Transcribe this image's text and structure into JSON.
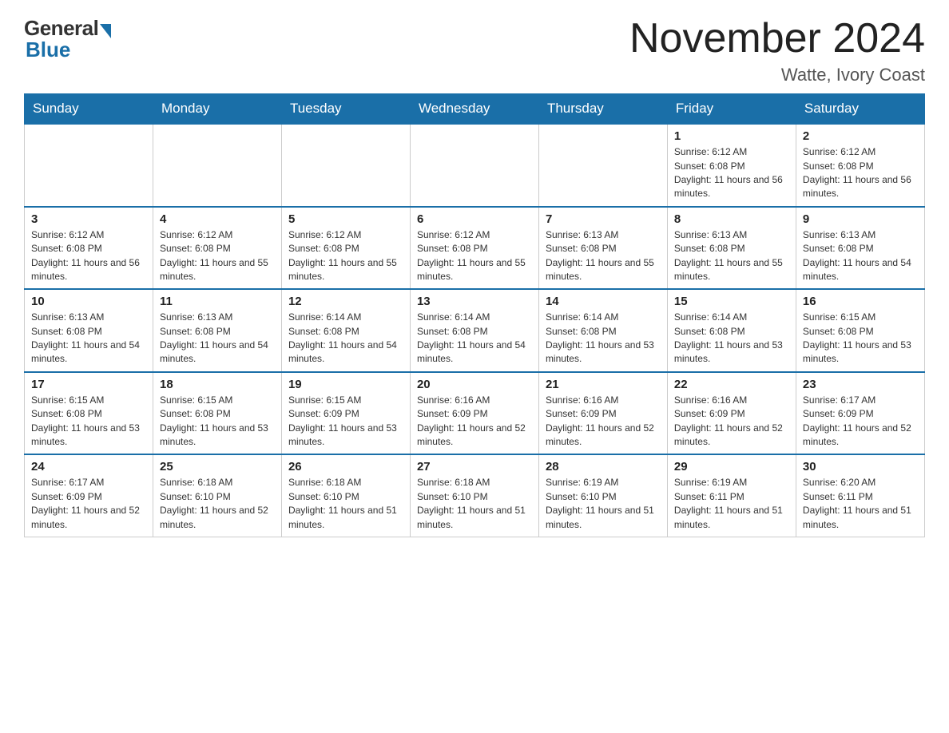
{
  "logo": {
    "general": "General",
    "blue": "Blue"
  },
  "title": "November 2024",
  "location": "Watte, Ivory Coast",
  "days_of_week": [
    "Sunday",
    "Monday",
    "Tuesday",
    "Wednesday",
    "Thursday",
    "Friday",
    "Saturday"
  ],
  "weeks": [
    [
      {
        "day": "",
        "info": ""
      },
      {
        "day": "",
        "info": ""
      },
      {
        "day": "",
        "info": ""
      },
      {
        "day": "",
        "info": ""
      },
      {
        "day": "",
        "info": ""
      },
      {
        "day": "1",
        "info": "Sunrise: 6:12 AM\nSunset: 6:08 PM\nDaylight: 11 hours and 56 minutes."
      },
      {
        "day": "2",
        "info": "Sunrise: 6:12 AM\nSunset: 6:08 PM\nDaylight: 11 hours and 56 minutes."
      }
    ],
    [
      {
        "day": "3",
        "info": "Sunrise: 6:12 AM\nSunset: 6:08 PM\nDaylight: 11 hours and 56 minutes."
      },
      {
        "day": "4",
        "info": "Sunrise: 6:12 AM\nSunset: 6:08 PM\nDaylight: 11 hours and 55 minutes."
      },
      {
        "day": "5",
        "info": "Sunrise: 6:12 AM\nSunset: 6:08 PM\nDaylight: 11 hours and 55 minutes."
      },
      {
        "day": "6",
        "info": "Sunrise: 6:12 AM\nSunset: 6:08 PM\nDaylight: 11 hours and 55 minutes."
      },
      {
        "day": "7",
        "info": "Sunrise: 6:13 AM\nSunset: 6:08 PM\nDaylight: 11 hours and 55 minutes."
      },
      {
        "day": "8",
        "info": "Sunrise: 6:13 AM\nSunset: 6:08 PM\nDaylight: 11 hours and 55 minutes."
      },
      {
        "day": "9",
        "info": "Sunrise: 6:13 AM\nSunset: 6:08 PM\nDaylight: 11 hours and 54 minutes."
      }
    ],
    [
      {
        "day": "10",
        "info": "Sunrise: 6:13 AM\nSunset: 6:08 PM\nDaylight: 11 hours and 54 minutes."
      },
      {
        "day": "11",
        "info": "Sunrise: 6:13 AM\nSunset: 6:08 PM\nDaylight: 11 hours and 54 minutes."
      },
      {
        "day": "12",
        "info": "Sunrise: 6:14 AM\nSunset: 6:08 PM\nDaylight: 11 hours and 54 minutes."
      },
      {
        "day": "13",
        "info": "Sunrise: 6:14 AM\nSunset: 6:08 PM\nDaylight: 11 hours and 54 minutes."
      },
      {
        "day": "14",
        "info": "Sunrise: 6:14 AM\nSunset: 6:08 PM\nDaylight: 11 hours and 53 minutes."
      },
      {
        "day": "15",
        "info": "Sunrise: 6:14 AM\nSunset: 6:08 PM\nDaylight: 11 hours and 53 minutes."
      },
      {
        "day": "16",
        "info": "Sunrise: 6:15 AM\nSunset: 6:08 PM\nDaylight: 11 hours and 53 minutes."
      }
    ],
    [
      {
        "day": "17",
        "info": "Sunrise: 6:15 AM\nSunset: 6:08 PM\nDaylight: 11 hours and 53 minutes."
      },
      {
        "day": "18",
        "info": "Sunrise: 6:15 AM\nSunset: 6:08 PM\nDaylight: 11 hours and 53 minutes."
      },
      {
        "day": "19",
        "info": "Sunrise: 6:15 AM\nSunset: 6:09 PM\nDaylight: 11 hours and 53 minutes."
      },
      {
        "day": "20",
        "info": "Sunrise: 6:16 AM\nSunset: 6:09 PM\nDaylight: 11 hours and 52 minutes."
      },
      {
        "day": "21",
        "info": "Sunrise: 6:16 AM\nSunset: 6:09 PM\nDaylight: 11 hours and 52 minutes."
      },
      {
        "day": "22",
        "info": "Sunrise: 6:16 AM\nSunset: 6:09 PM\nDaylight: 11 hours and 52 minutes."
      },
      {
        "day": "23",
        "info": "Sunrise: 6:17 AM\nSunset: 6:09 PM\nDaylight: 11 hours and 52 minutes."
      }
    ],
    [
      {
        "day": "24",
        "info": "Sunrise: 6:17 AM\nSunset: 6:09 PM\nDaylight: 11 hours and 52 minutes."
      },
      {
        "day": "25",
        "info": "Sunrise: 6:18 AM\nSunset: 6:10 PM\nDaylight: 11 hours and 52 minutes."
      },
      {
        "day": "26",
        "info": "Sunrise: 6:18 AM\nSunset: 6:10 PM\nDaylight: 11 hours and 51 minutes."
      },
      {
        "day": "27",
        "info": "Sunrise: 6:18 AM\nSunset: 6:10 PM\nDaylight: 11 hours and 51 minutes."
      },
      {
        "day": "28",
        "info": "Sunrise: 6:19 AM\nSunset: 6:10 PM\nDaylight: 11 hours and 51 minutes."
      },
      {
        "day": "29",
        "info": "Sunrise: 6:19 AM\nSunset: 6:11 PM\nDaylight: 11 hours and 51 minutes."
      },
      {
        "day": "30",
        "info": "Sunrise: 6:20 AM\nSunset: 6:11 PM\nDaylight: 11 hours and 51 minutes."
      }
    ]
  ]
}
